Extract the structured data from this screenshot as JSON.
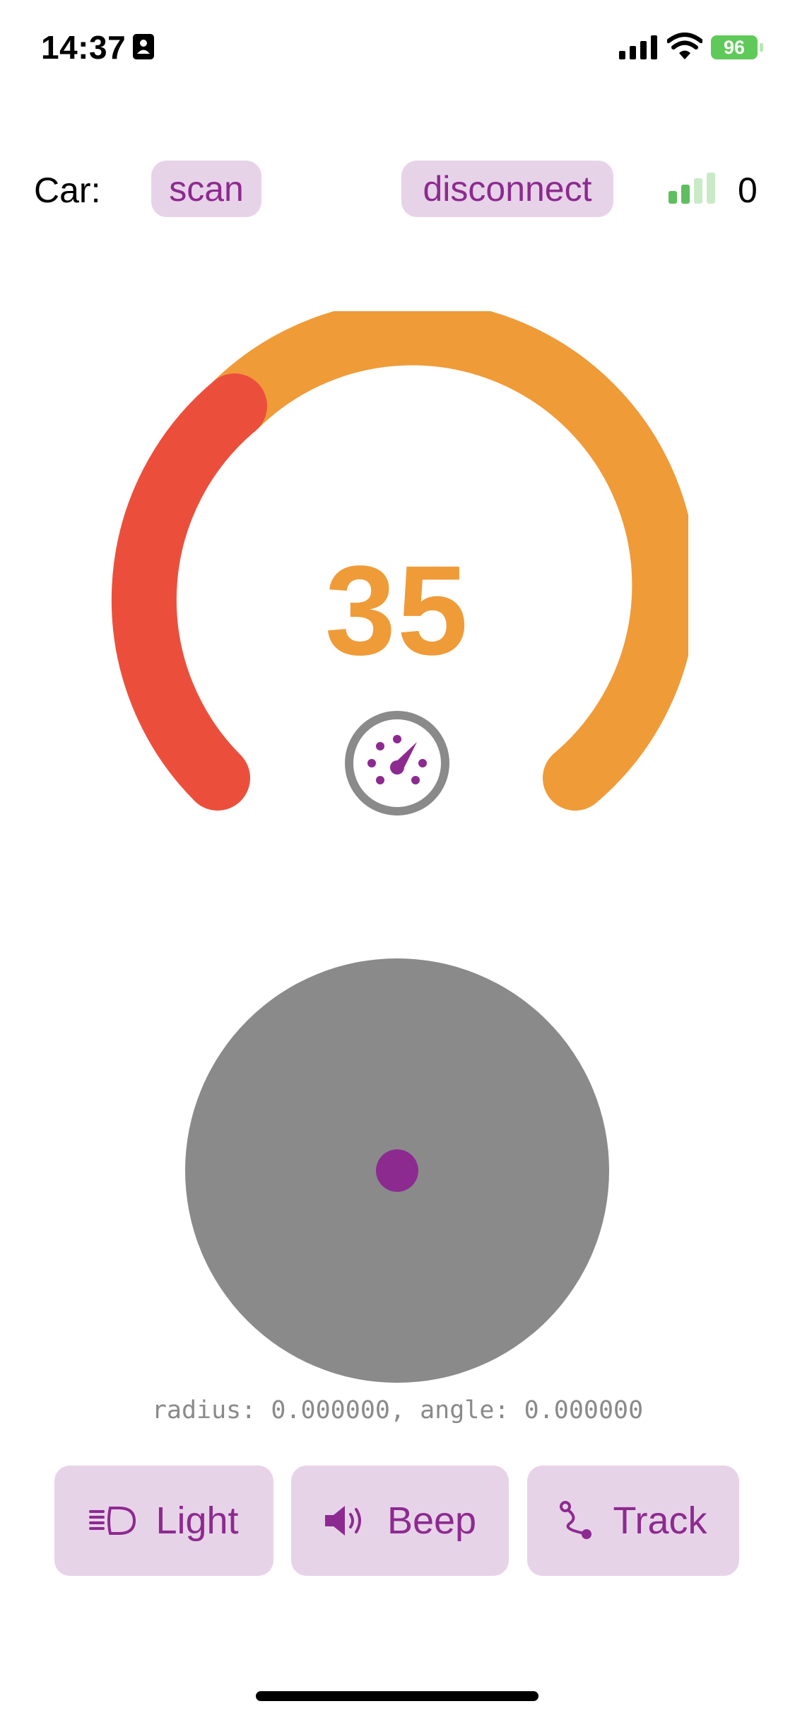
{
  "status_bar": {
    "time": "14:37",
    "battery_percent": "96",
    "icons": [
      "contact-card-icon",
      "cellular-signal-icon",
      "wifi-icon",
      "battery-charging-icon"
    ]
  },
  "car_row": {
    "label": "Car:",
    "scan_label": "scan",
    "disconnect_label": "disconnect",
    "rssi_value": "0",
    "rssi_icon": "signal-strength-icon"
  },
  "gauge": {
    "value": "35",
    "icon": "speedometer-icon",
    "colors": {
      "low": "#eb4f3c",
      "main": "#ef9b38"
    }
  },
  "joystick": {
    "readout": "radius: 0.000000, angle: 0.000000",
    "colors": {
      "pad": "#8a8a8b",
      "knob": "#8d2a90"
    }
  },
  "actions": {
    "light_label": "Light",
    "beep_label": "Beep",
    "track_label": "Track",
    "icons": [
      "headlight-icon",
      "speaker-icon",
      "route-icon"
    ]
  },
  "colors": {
    "accent": "#8d2a90",
    "chip_bg": "#e7d3e8"
  }
}
